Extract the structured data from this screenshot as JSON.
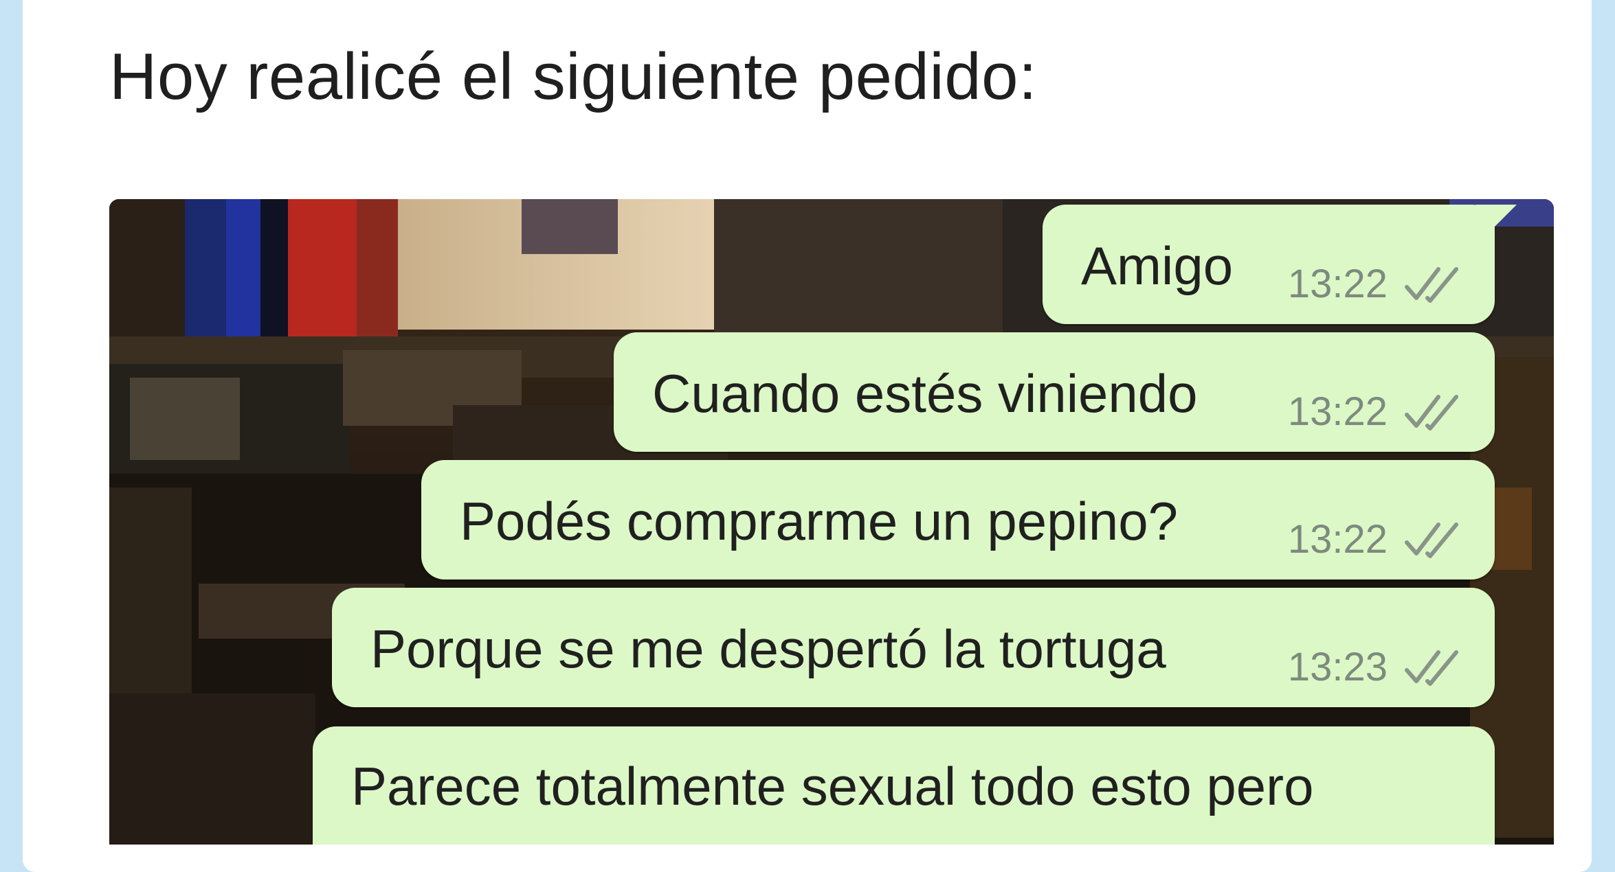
{
  "post": {
    "text": "Hoy realicé el siguiente pedido:"
  },
  "chat": {
    "messages": [
      {
        "text": "Amigo",
        "time": "13:22",
        "status": "read"
      },
      {
        "text": "Cuando estés viniendo",
        "time": "13:22",
        "status": "read"
      },
      {
        "text": "Podés comprarme un pepino?",
        "time": "13:22",
        "status": "read"
      },
      {
        "text": "Porque se me despertó la tortuga",
        "time": "13:23",
        "status": "read"
      },
      {
        "text": "Parece totalmente sexual todo esto pero"
      }
    ],
    "colors": {
      "bubble": "#dcf8c6",
      "time": "#7e8a7e",
      "tick": "#8a948a"
    }
  },
  "icons": {
    "read_receipt": "double-check-icon"
  }
}
